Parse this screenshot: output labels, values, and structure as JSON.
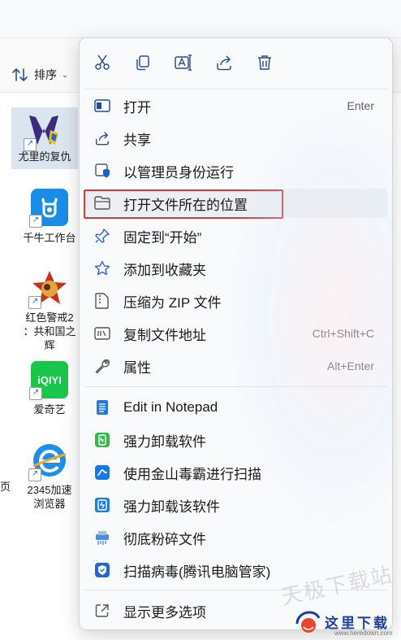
{
  "explorer": {
    "sort_label": "排序",
    "files": [
      {
        "name": "尤里的复仇",
        "icon": "yuri-revenge-icon"
      },
      {
        "name": "千牛工作台",
        "icon": "qianniu-icon"
      },
      {
        "name": "红色警戒2：共和国之辉",
        "icon": "red-alert-icon"
      },
      {
        "name": "爱奇艺",
        "icon": "iqiyi-icon"
      },
      {
        "name": "2345加速浏览器",
        "icon": "browser-2345-icon"
      }
    ],
    "file_label_lines": {
      "yuri": "尤里的复仇",
      "qianniu": "千牛工作台",
      "redalert_1": "红色警戒2",
      "redalert_2": "：共和国之",
      "redalert_3": "辉",
      "iqiyi_logo": "iQIYI",
      "iqiyi": "爱奇艺",
      "b2345_1": "2345加速",
      "b2345_2": "浏览器",
      "left_edge": "页"
    }
  },
  "context_menu": {
    "quick_actions": [
      "cut-icon",
      "copy-icon",
      "rename-icon",
      "share-icon",
      "delete-icon"
    ],
    "items": [
      {
        "label": "打开",
        "accel": "Enter",
        "icon": "open-icon"
      },
      {
        "label": "共享",
        "accel": "",
        "icon": "share-icon"
      },
      {
        "label": "以管理员身份运行",
        "accel": "",
        "icon": "admin-shield-icon"
      },
      {
        "label": "打开文件所在的位置",
        "accel": "",
        "icon": "folder-icon",
        "highlighted": true
      },
      {
        "label": "固定到“开始”",
        "accel": "",
        "icon": "pin-icon"
      },
      {
        "label": "添加到收藏夹",
        "accel": "",
        "icon": "star-icon"
      },
      {
        "label": "压缩为 ZIP 文件",
        "accel": "",
        "icon": "zip-icon"
      },
      {
        "label": "复制文件地址",
        "accel": "Ctrl+Shift+C",
        "icon": "copy-path-icon"
      },
      {
        "label": "属性",
        "accel": "Alt+Enter",
        "icon": "wrench-icon"
      },
      {
        "label": "Edit in Notepad",
        "accel": "",
        "icon": "notepad-icon"
      },
      {
        "label": "强力卸载软件",
        "accel": "",
        "icon": "uninstall-icon"
      },
      {
        "label": "使用金山毒霸进行扫描",
        "accel": "",
        "icon": "kingsoft-icon"
      },
      {
        "label": "强力卸载该软件",
        "accel": "",
        "icon": "uninstall-this-icon"
      },
      {
        "label": "彻底粉碎文件",
        "accel": "",
        "icon": "shred-icon"
      },
      {
        "label": "扫描病毒(腾讯电脑管家)",
        "accel": "",
        "icon": "tencent-shield-icon"
      },
      {
        "label": "显示更多选项",
        "accel": "",
        "icon": "more-options-icon"
      }
    ]
  },
  "watermark": "天极下载站",
  "logo": {
    "text": "这里下载",
    "sub": "www.heredown.com"
  },
  "colors": {
    "accent": "#1a6fd1",
    "highlight_border": "#d43a3a"
  }
}
